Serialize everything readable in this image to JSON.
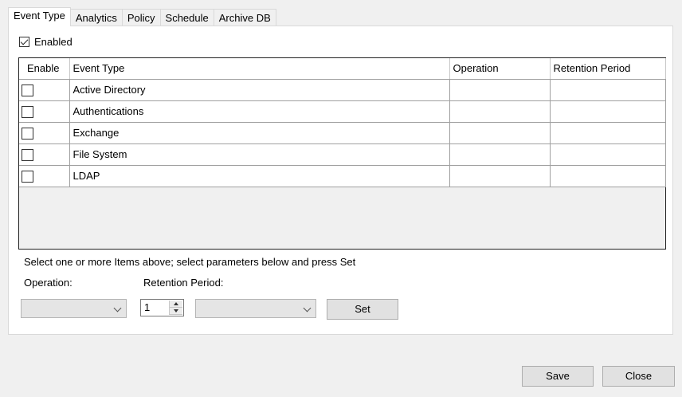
{
  "tabs": [
    "Event Type",
    "Analytics",
    "Policy",
    "Schedule",
    "Archive DB"
  ],
  "enabled_checkbox": {
    "label": "Enabled",
    "checked": true
  },
  "grid": {
    "columns": [
      "Enable",
      "Event Type",
      "Operation",
      "Retention Period"
    ],
    "rows": [
      {
        "enable": false,
        "event_type": "Active Directory",
        "operation": "",
        "retention": ""
      },
      {
        "enable": false,
        "event_type": "Authentications",
        "operation": "",
        "retention": ""
      },
      {
        "enable": false,
        "event_type": "Exchange",
        "operation": "",
        "retention": ""
      },
      {
        "enable": false,
        "event_type": "File System",
        "operation": "",
        "retention": ""
      },
      {
        "enable": false,
        "event_type": "LDAP",
        "operation": "",
        "retention": ""
      }
    ]
  },
  "hint": "Select one or more Items above; select parameters below and press Set",
  "operation_label": "Operation:",
  "retention_label": "Retention Period:",
  "operation_value": "",
  "retention_value": "1",
  "retention_unit_value": "",
  "buttons": {
    "set": "Set",
    "save": "Save",
    "close": "Close"
  }
}
